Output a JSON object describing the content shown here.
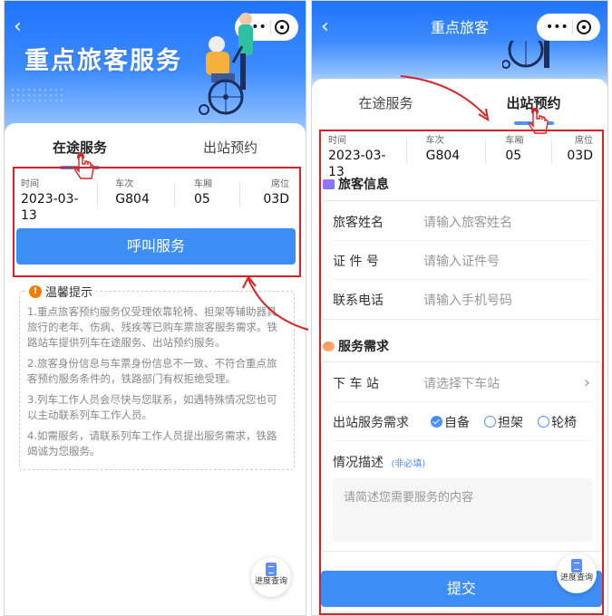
{
  "left": {
    "hero_title": "重点旅客服务",
    "tabs": [
      "在途服务",
      "出站预约"
    ],
    "info": [
      {
        "label": "时间",
        "value": "2023-03-13"
      },
      {
        "label": "车次",
        "value": "G804"
      },
      {
        "label": "车厢",
        "value": "05"
      },
      {
        "label": "席位",
        "value": "03D"
      }
    ],
    "call_button": "呼叫服务",
    "tips_title": "温馨提示",
    "tips": [
      "1.重点旅客预约服务仅受理依靠轮椅、担架等辅助器具旅行的老年、伤病、残疾等已购车票旅客服务需求。铁路站车提供列车在途服务、出站预约服务。",
      "2.旅客身份信息与车票身份信息不一致、不符合重点旅客预约服务条件的，铁路部门有权拒绝受理。",
      "3.列车工作人员会尽快与您联系，如遇特殊情况您也可以主动联系列车工作人员。",
      "4.如需服务，请联系列车工作人员提出服务需求，铁路竭诚为您服务。"
    ],
    "progress_query": "进度查询"
  },
  "right": {
    "nav_title": "重点旅客",
    "tabs": [
      "在途服务",
      "出站预约"
    ],
    "info": [
      {
        "label": "时间",
        "value": "2023-03-13"
      },
      {
        "label": "车次",
        "value": "G804"
      },
      {
        "label": "车厢",
        "value": "05"
      },
      {
        "label": "席位",
        "value": "03D"
      }
    ],
    "passenger_section": "旅客信息",
    "passenger_fields": [
      {
        "label": "旅客姓名",
        "placeholder": "请输入旅客姓名"
      },
      {
        "label": "证 件 号",
        "placeholder": "请输入证件号"
      },
      {
        "label": "联系电话",
        "placeholder": "请输入手机号码"
      }
    ],
    "service_section": "服务需求",
    "station_label": "下 车 站",
    "station_placeholder": "请选择下车站",
    "exit_label": "出站服务需求",
    "exit_options": [
      "自备",
      "担架",
      "轮椅"
    ],
    "desc_label": "情况描述",
    "desc_optional": "(非必填)",
    "desc_placeholder": "请简述您需要服务的内容",
    "submit": "提交",
    "progress_query": "进度查询"
  },
  "colors": {
    "accent": "#3d8ef7",
    "highlight": "#e02020",
    "warning": "#f57c00"
  }
}
